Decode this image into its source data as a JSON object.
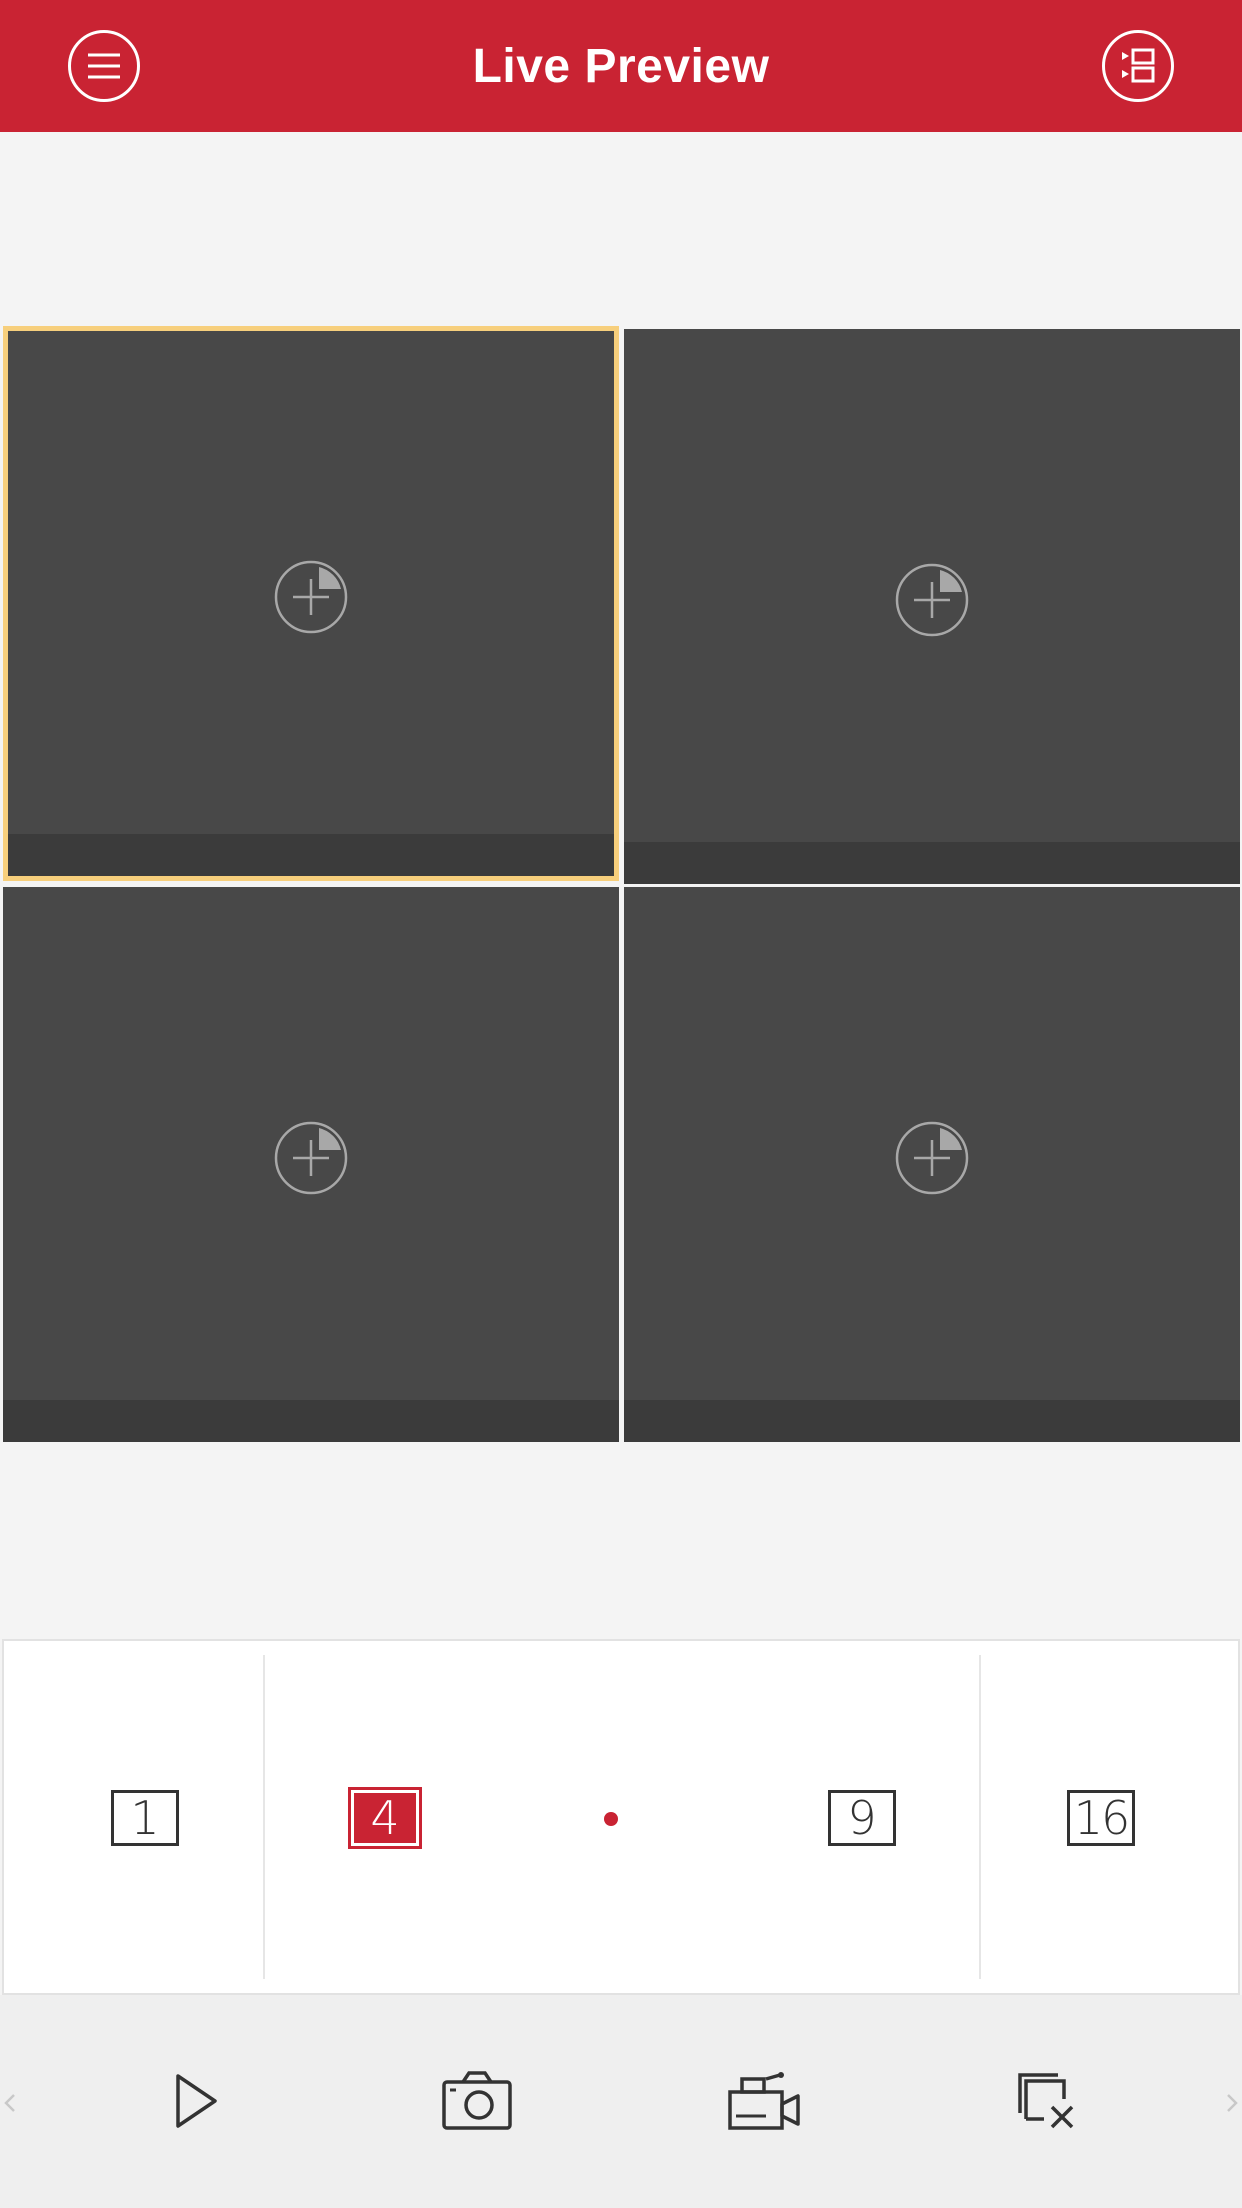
{
  "theme": {
    "accent": "#c92333",
    "selected_border": "#f7cf7c"
  },
  "header": {
    "title": "Live Preview",
    "menu_icon": "menu-icon",
    "device_list_icon": "device-list-icon"
  },
  "grid": {
    "tiles": [
      {
        "name": "tile-1",
        "selected": true,
        "icon": "add-camera-icon"
      },
      {
        "name": "tile-2",
        "selected": false,
        "icon": "add-camera-icon"
      },
      {
        "name": "tile-3",
        "selected": false,
        "icon": "add-camera-icon"
      },
      {
        "name": "tile-4",
        "selected": false,
        "icon": "add-camera-icon"
      }
    ]
  },
  "layout_selector": {
    "options": [
      "1",
      "4",
      "9",
      "16"
    ],
    "selected": "4"
  },
  "toolbar": {
    "tools": [
      "play-icon",
      "camera-capture-icon",
      "record-video-icon",
      "close-all-icon"
    ],
    "prev_icon": "chevron-left-icon",
    "next_icon": "chevron-right-icon"
  }
}
